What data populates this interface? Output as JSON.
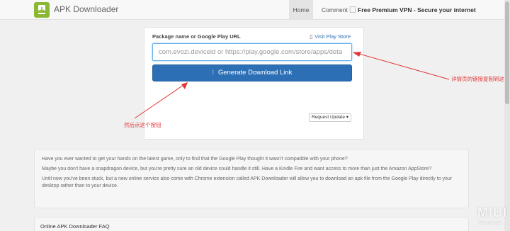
{
  "navbar": {
    "brand": "APK Downloader",
    "items": [
      {
        "label": "Home",
        "active": true
      },
      {
        "label": "Comment",
        "active": false
      },
      {
        "label": "Free Premium VPN - Secure your internet",
        "active": false
      }
    ],
    "vpn_glyph": "⃞"
  },
  "panel": {
    "label": "Package name or Google Play URL",
    "play_link": "Visit Play Store",
    "play_glyph": "▯",
    "input_placeholder": "com.evozi.deviceid or https://play.google.com/store/apps/deta",
    "input_value": "",
    "generate_button": "Generate Download Link",
    "generate_glyph": "⁞",
    "request_update": "Request Update ▾"
  },
  "annotations": {
    "right": "详情页的链接复制到这",
    "bottom": "然后点这个按钮"
  },
  "info": {
    "p1": "Have you ever wanted to get your hands on the latest game, only to find that the Google Play thought it wasn't compatible with your phone?",
    "p2": "Maybe you don't have a snapdragon device, but you're pretty sure an old device could handle it still. Have a Kindle Fire and want access to more than just the Amazon AppStore?",
    "p3": "Until now you've been stuck, but a new online service also come with Chrome extension called APK Downloader will allow you to download an apk file from the Google Play directly to your desktop rather than to your device."
  },
  "faq_title": "Online APK Downloader FAQ",
  "watermark": {
    "main": "MIUI",
    "sub": "bbs.miui.com"
  },
  "colors": {
    "accent": "#2c6fb5",
    "annotation": "#e23535",
    "brand": "#8ab833"
  }
}
